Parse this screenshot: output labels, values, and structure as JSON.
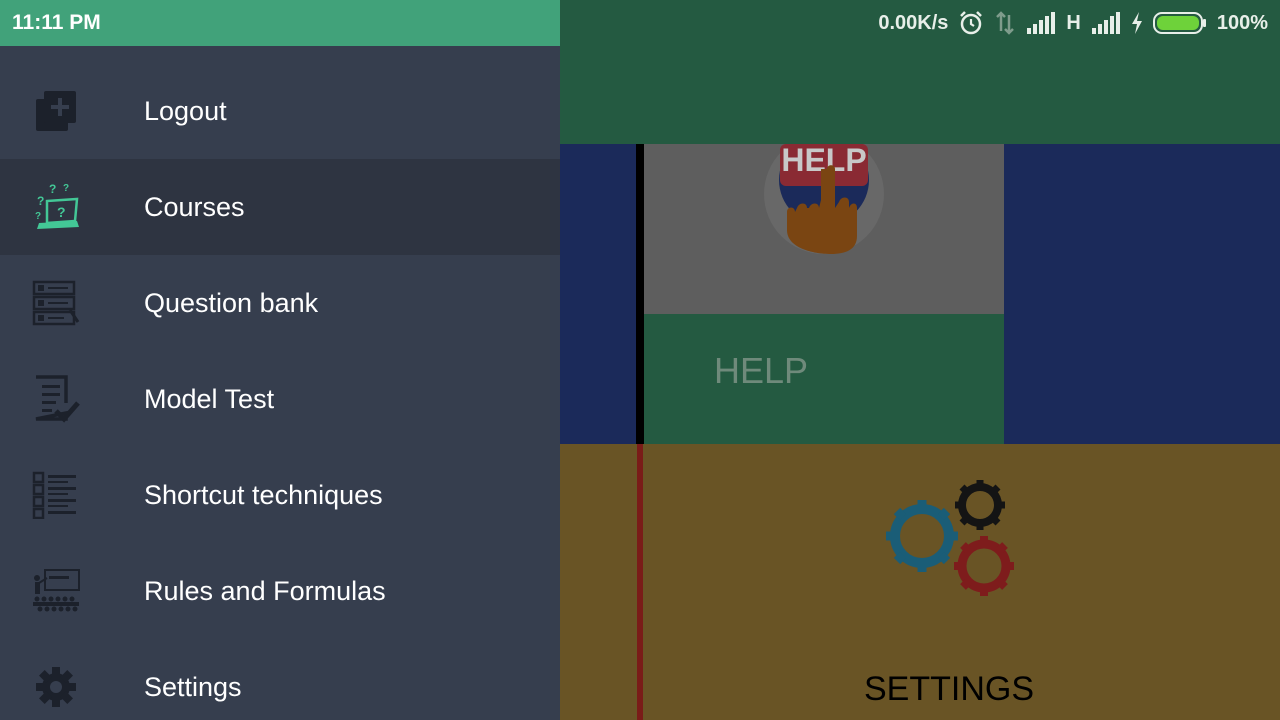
{
  "status_bar": {
    "time": "11:11 PM",
    "speed": "0.00K/s",
    "network_type": "H",
    "battery": "100%"
  },
  "drawer": {
    "items": [
      {
        "label": "Logout",
        "icon": "add-to-library-icon"
      },
      {
        "label": "Courses",
        "icon": "laptop-questions-icon",
        "active": true
      },
      {
        "label": "Question bank",
        "icon": "question-list-icon"
      },
      {
        "label": "Model Test",
        "icon": "checklist-icon"
      },
      {
        "label": "Shortcut techniques",
        "icon": "bullet-list-icon"
      },
      {
        "label": "Rules and Formulas",
        "icon": "classroom-board-icon"
      },
      {
        "label": "Settings",
        "icon": "gear-icon"
      }
    ]
  },
  "main": {
    "help_card": {
      "label": "HELP",
      "image_text": "HELP"
    },
    "settings_card": {
      "label": "SETTINGS"
    }
  },
  "colors": {
    "drawer_bg": "#363e4e",
    "status_bar_left": "#41a27a",
    "app_bar": "#245a41",
    "accent_green": "#43c796"
  }
}
